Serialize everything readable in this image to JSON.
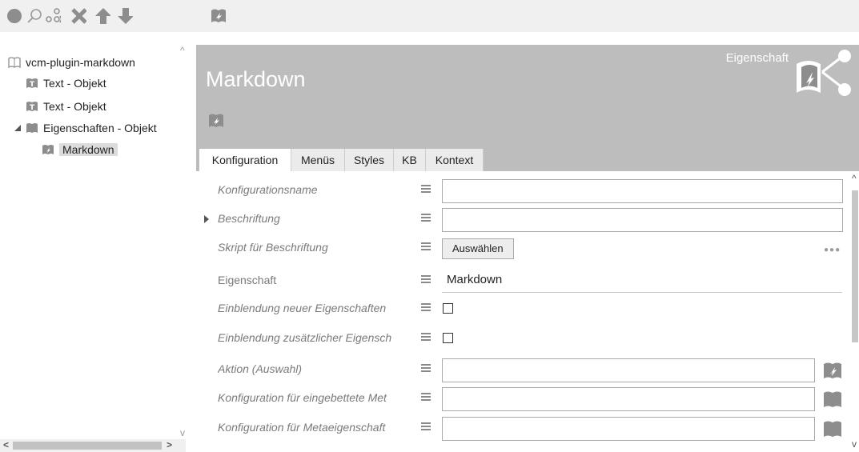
{
  "toolbar": {
    "icons": [
      "circle-icon",
      "search-icon",
      "unlink-icon",
      "delete-icon",
      "arrow-up-icon",
      "arrow-down-icon",
      "plugin-icon"
    ]
  },
  "tree": {
    "items": [
      {
        "label": "vcm-plugin-markdown",
        "icon": "book-icon"
      },
      {
        "label": "Text - Objekt",
        "icon": "text-object-icon"
      },
      {
        "label": "Text - Objekt",
        "icon": "text-object-icon"
      },
      {
        "label": "Eigenschaften - Objekt",
        "icon": "folder-icon",
        "expanded": true
      },
      {
        "label": "Markdown",
        "icon": "property-icon",
        "selected": true
      }
    ],
    "scroll_up": "^",
    "scroll_down": "v",
    "scroll_left": "<",
    "scroll_right": ">"
  },
  "header": {
    "title": "Markdown",
    "type_label": "Eigenschaft"
  },
  "tabs": [
    {
      "label": "Konfiguration",
      "active": true
    },
    {
      "label": "Menüs"
    },
    {
      "label": "Styles"
    },
    {
      "label": "KB"
    },
    {
      "label": "Kontext"
    }
  ],
  "form": {
    "rows": [
      {
        "label": "Konfigurationsname",
        "type": "input",
        "value": ""
      },
      {
        "label": "Beschriftung",
        "type": "input",
        "value": "",
        "expandable": true
      },
      {
        "label": "Skript für Beschriftung",
        "type": "button",
        "button_label": "Auswählen",
        "more": "●●●"
      },
      {
        "label": "Eigenschaft",
        "type": "value",
        "value": "Markdown"
      },
      {
        "label": "Einblendung neuer Eigenschaften",
        "type": "checkbox",
        "checked": false
      },
      {
        "label": "Einblendung zusätzlicher Eigensch",
        "type": "checkbox",
        "checked": false
      },
      {
        "label": "Aktion (Auswahl)",
        "type": "input-icon",
        "value": "",
        "icon": "action-icon"
      },
      {
        "label": "Konfiguration für eingebettete Met",
        "type": "input-icon",
        "value": "",
        "icon": "folder-icon"
      },
      {
        "label": "Konfiguration für Metaeigenschaft",
        "type": "input-icon",
        "value": "",
        "icon": "folder-icon"
      }
    ]
  },
  "colors": {
    "header_bg": "#bdbdbd",
    "icon_gray": "#8d8d8d",
    "selected_bg": "#dcdcdc"
  }
}
